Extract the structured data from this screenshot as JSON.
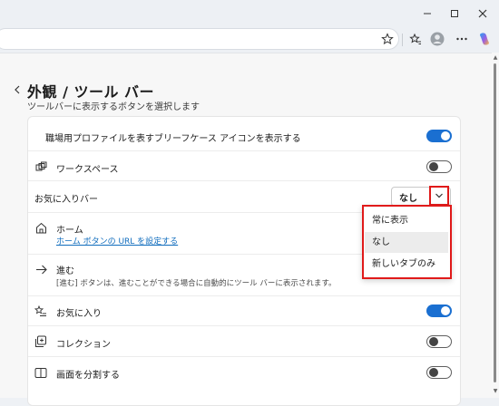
{
  "page": {
    "title": "外観 / ツール バー",
    "subtitle": "ツールバーに表示するボタンを選択します"
  },
  "settings": {
    "work_profile": {
      "label": "職場用プロファイルを表すブリーフケース アイコンを表示する",
      "enabled": true
    },
    "workspaces": {
      "label": "ワークスペース",
      "enabled": false
    },
    "favorites_bar": {
      "label": "お気に入りバー",
      "selected": "なし"
    },
    "home": {
      "label": "ホーム",
      "link": "ホーム ボタンの URL を設定する"
    },
    "forward": {
      "label": "進む",
      "description": "[進む] ボタンは、進むことができる場合に自動的にツール バーに表示されます。"
    },
    "favorites": {
      "label": "お気に入り",
      "enabled": true
    },
    "collections": {
      "label": "コレクション",
      "enabled": false
    },
    "split_screen": {
      "label": "画面を分割する",
      "enabled": false
    }
  },
  "dropdown": {
    "options": [
      "常に表示",
      "なし",
      "新しいタブのみ"
    ],
    "selected_index": 1
  },
  "colors": {
    "accent": "#1a6fd1",
    "highlight_border": "#e01a1a",
    "link": "#0f6cbd"
  },
  "icons": {
    "back": "chevron-left-icon",
    "workspaces": "workspaces-icon",
    "home": "home-icon",
    "forward": "arrow-right-icon",
    "favorites": "favorites-star-list-icon",
    "collections": "collections-icon",
    "split_screen": "split-screen-icon"
  }
}
